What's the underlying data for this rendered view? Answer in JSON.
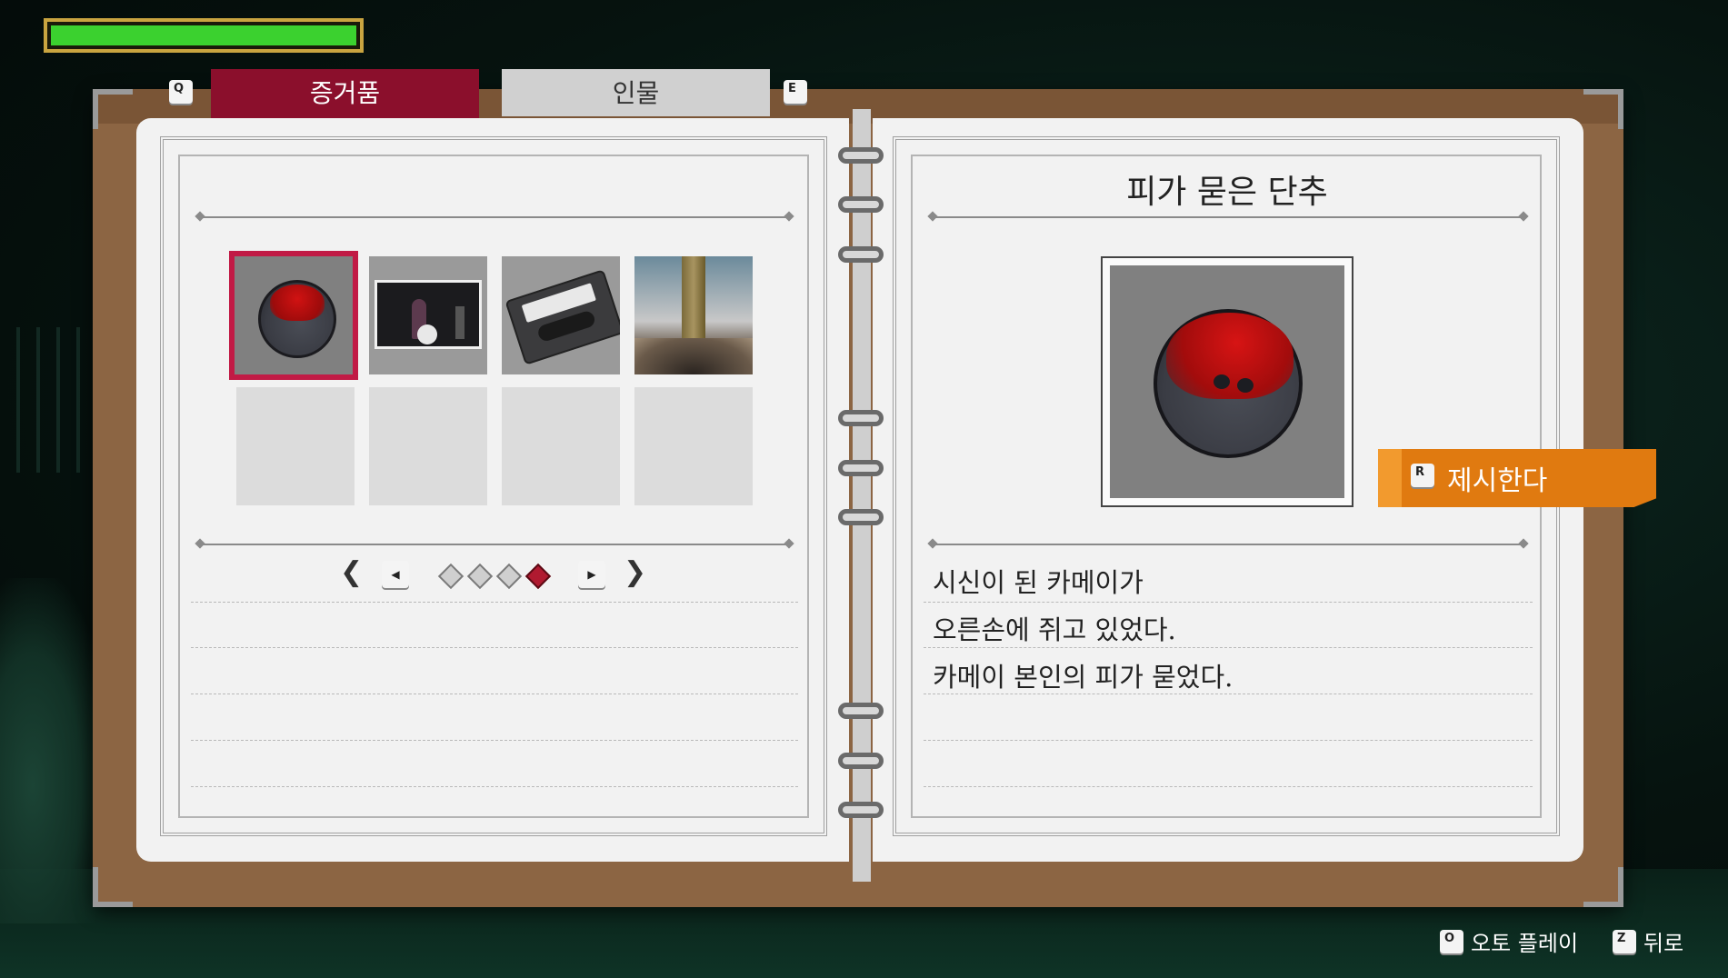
{
  "hud": {
    "health_percent": 100
  },
  "tabs": {
    "prev_key": "Q",
    "next_key": "E",
    "items": [
      {
        "label": "증거품",
        "active": true
      },
      {
        "label": "인물",
        "active": false
      }
    ]
  },
  "evidence_grid": {
    "items": [
      {
        "icon": "bloody-button",
        "selected": true
      },
      {
        "icon": "snowman-scene-photo",
        "selected": false
      },
      {
        "icon": "cassette-tape",
        "selected": false
      },
      {
        "icon": "snowy-pole-photo",
        "selected": false
      },
      {
        "icon": "empty",
        "selected": false
      },
      {
        "icon": "empty",
        "selected": false
      },
      {
        "icon": "empty",
        "selected": false
      },
      {
        "icon": "empty",
        "selected": false
      }
    ],
    "pagination": {
      "total": 4,
      "current": 4
    }
  },
  "detail": {
    "title": "피가 묻은 단추",
    "description": [
      "시신이 된 카메이가",
      "오른손에 쥐고 있었다.",
      "카메이 본인의 피가 묻었다."
    ],
    "present_key": "R",
    "present_label": "제시한다"
  },
  "hints": [
    {
      "key": "O",
      "label": "오토 플레이"
    },
    {
      "key": "Z",
      "label": "뒤로"
    }
  ],
  "colors": {
    "accent": "#8b0f2c",
    "present": "#e07a10",
    "health": "#3bd12f"
  }
}
